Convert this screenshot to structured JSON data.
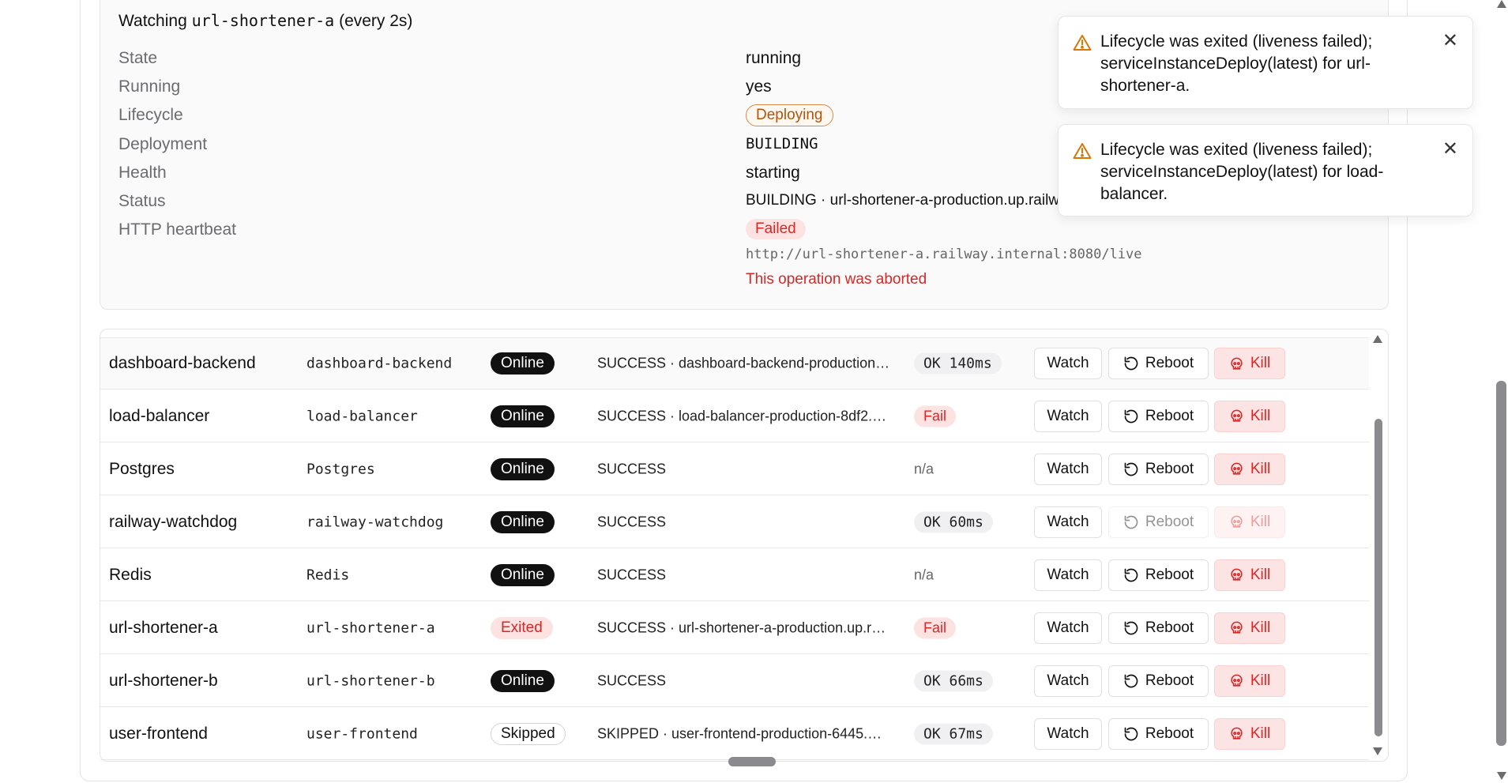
{
  "watch": {
    "title_prefix": "Watching",
    "service": "url-shortener-a",
    "title_suffix": "(every 2s)",
    "labels": {
      "state": "State",
      "running": "Running",
      "lifecycle": "Lifecycle",
      "deployment": "Deployment",
      "health": "Health",
      "status": "Status",
      "heartbeat": "HTTP heartbeat"
    },
    "values": {
      "state": "running",
      "running": "yes",
      "lifecycle": "Deploying",
      "deployment": "BUILDING",
      "health": "starting",
      "status": "BUILDING · url-shortener-a-production.up.railway.app",
      "heartbeat": "Failed",
      "heartbeat_url": "http://url-shortener-a.railway.internal:8080/live",
      "heartbeat_error": "This operation was aborted"
    }
  },
  "buttons": {
    "watch": "Watch",
    "reboot": "Reboot",
    "kill": "Kill"
  },
  "services": [
    {
      "name": "dashboard-backend",
      "id": "dashboard-backend",
      "status": "Online",
      "deploy": "SUCCESS · dashboard-backend-production…",
      "health": "OK 140ms"
    },
    {
      "name": "load-balancer",
      "id": "load-balancer",
      "status": "Online",
      "deploy": "SUCCESS · load-balancer-production-8df2.…",
      "health": "Fail"
    },
    {
      "name": "Postgres",
      "id": "Postgres",
      "status": "Online",
      "deploy": "SUCCESS",
      "health": "n/a"
    },
    {
      "name": "railway-watchdog",
      "id": "railway-watchdog",
      "status": "Online",
      "deploy": "SUCCESS",
      "health": "OK 60ms"
    },
    {
      "name": "Redis",
      "id": "Redis",
      "status": "Online",
      "deploy": "SUCCESS",
      "health": "n/a"
    },
    {
      "name": "url-shortener-a",
      "id": "url-shortener-a",
      "status": "Exited",
      "deploy": "SUCCESS · url-shortener-a-production.up.r…",
      "health": "Fail"
    },
    {
      "name": "url-shortener-b",
      "id": "url-shortener-b",
      "status": "Online",
      "deploy": "SUCCESS",
      "health": "OK 66ms"
    },
    {
      "name": "user-frontend",
      "id": "user-frontend",
      "status": "Skipped",
      "deploy": "SKIPPED · user-frontend-production-6445.…",
      "health": "OK 67ms"
    }
  ],
  "toasts": [
    {
      "message": "Lifecycle was exited (liveness failed); serviceInstanceDeploy(latest) for url-shortener-a."
    },
    {
      "message": "Lifecycle was exited (liveness failed); serviceInstanceDeploy(latest) for load-balancer."
    }
  ],
  "colors": {
    "danger": "#dc2626",
    "warning": "#d97706",
    "online": "#111111"
  }
}
